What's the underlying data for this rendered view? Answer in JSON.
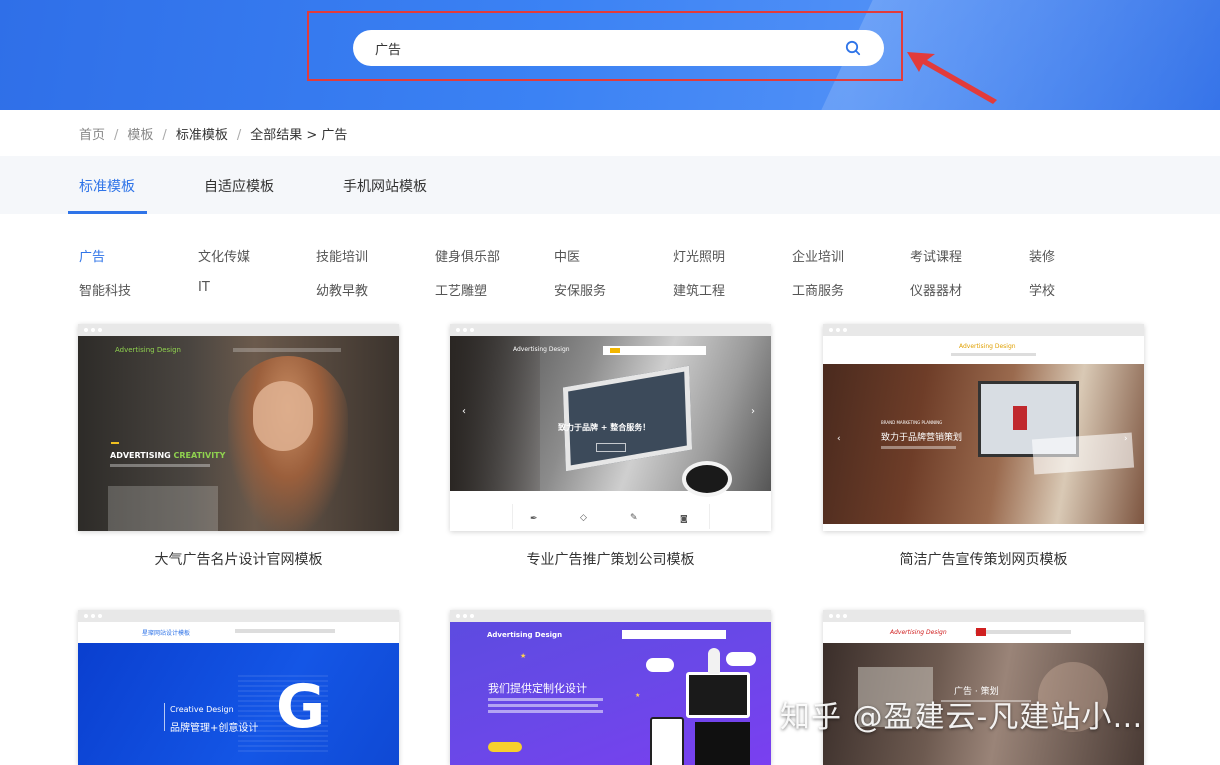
{
  "search": {
    "value": "广告"
  },
  "breadcrumb": {
    "home": "首页",
    "templates": "模板",
    "standard": "标准模板",
    "results": "全部结果 > 广告"
  },
  "tabs": [
    {
      "label": "标准模板",
      "active": true
    },
    {
      "label": "自适应模板",
      "active": false
    },
    {
      "label": "手机网站模板",
      "active": false
    }
  ],
  "categories": [
    {
      "label": "广告",
      "active": true
    },
    {
      "label": "文化传媒"
    },
    {
      "label": "技能培训"
    },
    {
      "label": "健身俱乐部"
    },
    {
      "label": "中医"
    },
    {
      "label": "灯光照明"
    },
    {
      "label": "企业培训"
    },
    {
      "label": "考试课程"
    },
    {
      "label": "装修"
    },
    {
      "label": "智能科技"
    },
    {
      "label": "IT"
    },
    {
      "label": "幼教早教"
    },
    {
      "label": "工艺雕塑"
    },
    {
      "label": "安保服务"
    },
    {
      "label": "建筑工程"
    },
    {
      "label": "工商服务"
    },
    {
      "label": "仪器器材"
    },
    {
      "label": "学校"
    }
  ],
  "cards": [
    {
      "title": "大气广告名片设计官网模板",
      "logo": "Advertising Design",
      "headline_a": "ADVERTISING ",
      "headline_b": "CREATIVITY"
    },
    {
      "title": "专业广告推广策划公司模板",
      "logo": "Advertising Design",
      "headline": "致力于品牌 + 整合服务！"
    },
    {
      "title": "简洁广告宣传策划网页模板",
      "logo": "Advertising Design",
      "sub": "BRAND MARKETING PLANNING",
      "headline": "致力于品牌营销策划"
    },
    {
      "title": "",
      "logo": "星璨网站设计模板",
      "line1": "Creative Design",
      "line2": "品牌管理+创意设计"
    },
    {
      "title": "",
      "logo": "Advertising Design",
      "headline": "我们提供定制化设计"
    },
    {
      "title": "",
      "logo": "Advertising Design",
      "headline": "广告 · 策划"
    }
  ],
  "watermark": "知乎 @盈建云-凡建站小…",
  "colors": {
    "accent": "#2f74e8",
    "banner": "#3b82f4",
    "highlight": "#e23b3b"
  }
}
